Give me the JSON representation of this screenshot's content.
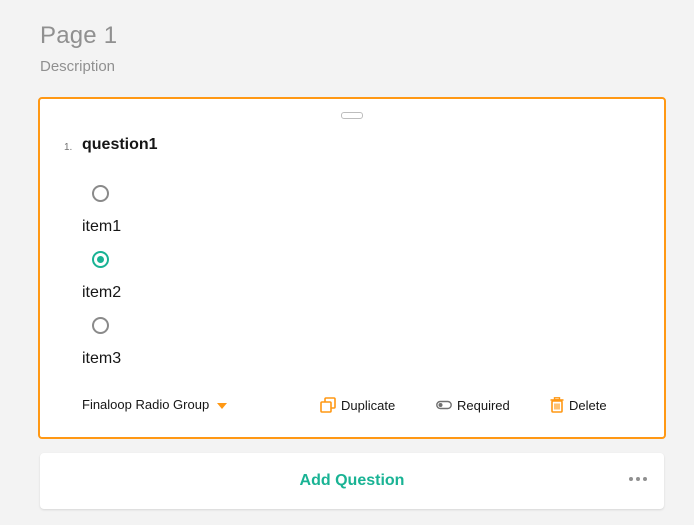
{
  "page": {
    "title": "Page 1",
    "description": "Description"
  },
  "question": {
    "number": "1.",
    "title": "question1",
    "choices": [
      {
        "label": "item1",
        "checked": false
      },
      {
        "label": "item2",
        "checked": true
      },
      {
        "label": "item3",
        "checked": false
      }
    ],
    "type_label": "Finaloop Radio Group",
    "actions": {
      "duplicate": "Duplicate",
      "required": "Required",
      "delete": "Delete"
    }
  },
  "add_question": {
    "label": "Add Question"
  },
  "colors": {
    "accent": "#ff9814",
    "primary": "#19b394",
    "muted": "#909090"
  },
  "icons": {
    "drag": "drag-handle-icon",
    "caret": "caret-down-icon",
    "duplicate": "duplicate-icon",
    "required": "toggle-icon",
    "delete": "trash-icon",
    "more": "more-dots-icon"
  }
}
